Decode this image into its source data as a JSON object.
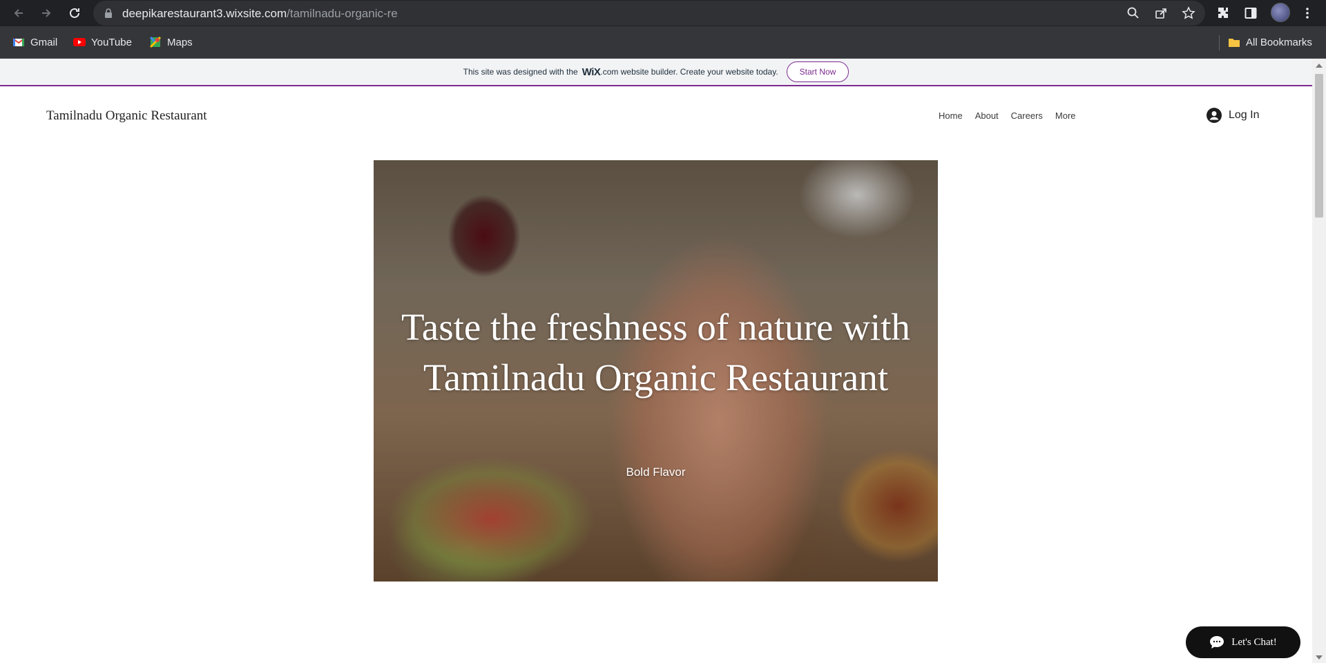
{
  "browser": {
    "url_domain": "deepikarestaurant3.wixsite.com",
    "url_path": "/tamilnadu-organic-re",
    "bookmarks": [
      {
        "label": "Gmail",
        "icon": "gmail-icon"
      },
      {
        "label": "YouTube",
        "icon": "youtube-icon"
      },
      {
        "label": "Maps",
        "icon": "maps-icon"
      }
    ],
    "all_bookmarks_label": "All Bookmarks"
  },
  "wix_banner": {
    "text_before": "This site was designed with the",
    "logo": "WiX",
    "text_after": ".com website builder. Create your website today.",
    "button_label": "Start Now",
    "accent_color": "#7b2a8f"
  },
  "site": {
    "title": "Tamilnadu Organic Restaurant",
    "nav": [
      "Home",
      "About",
      "Careers",
      "More"
    ],
    "login_label": "Log In"
  },
  "hero": {
    "title": "Taste the freshness of nature with Tamilnadu Organic Restaurant",
    "subtitle": "Bold Flavor"
  },
  "chat": {
    "label": "Let's Chat!"
  }
}
